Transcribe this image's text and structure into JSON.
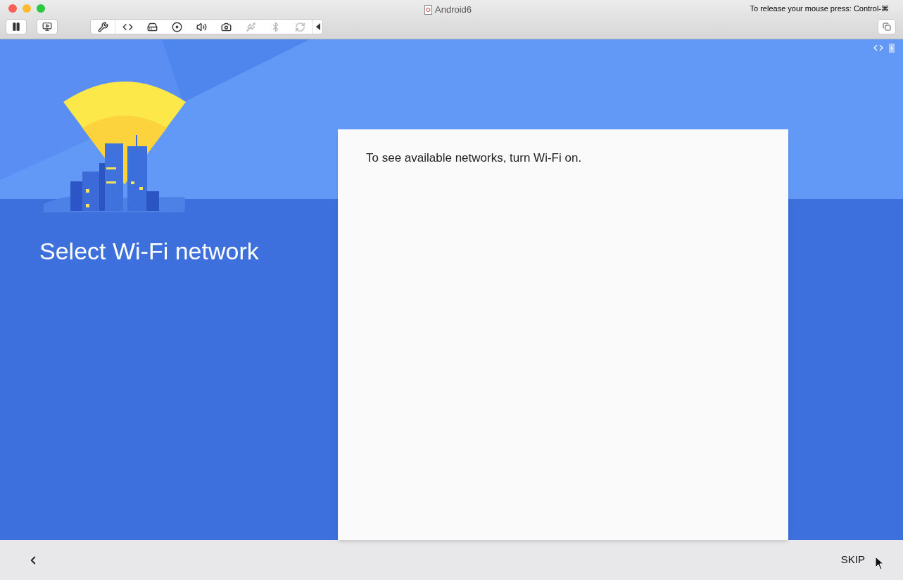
{
  "window": {
    "title": "Android6",
    "release_hint": "To release your mouse press: Control-⌘"
  },
  "toolbar": [
    {
      "kind": "settings",
      "disabled": false
    },
    {
      "kind": "network",
      "disabled": false
    },
    {
      "kind": "disk",
      "disabled": false
    },
    {
      "kind": "cdrom",
      "disabled": false
    },
    {
      "kind": "sound",
      "disabled": false
    },
    {
      "kind": "camera",
      "disabled": false
    },
    {
      "kind": "usb",
      "disabled": true
    },
    {
      "kind": "bluetooth",
      "disabled": true
    },
    {
      "kind": "sync",
      "disabled": true
    }
  ],
  "screen": {
    "heading": "Select Wi-Fi network",
    "message": "To see available networks, turn Wi-Fi on."
  },
  "nav": {
    "skip": "SKIP"
  }
}
